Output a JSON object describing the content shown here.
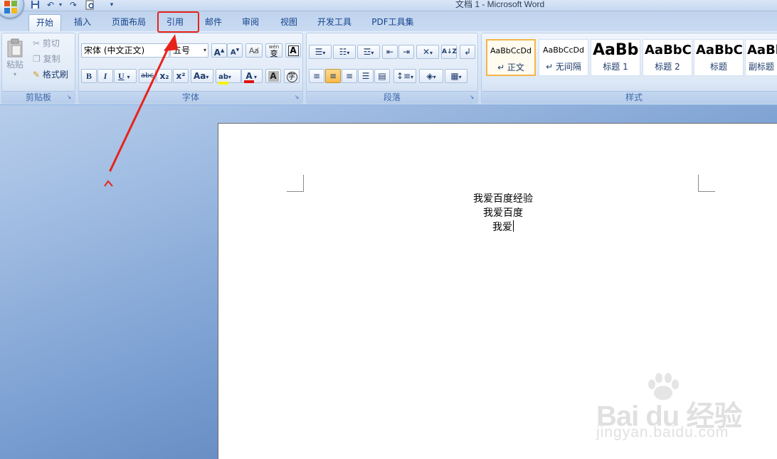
{
  "app": {
    "title": "文档 1 - Microsoft Word"
  },
  "quick_access": {
    "icons": [
      "save-icon",
      "undo-icon",
      "redo-icon",
      "print-preview-icon",
      "customize-icon"
    ]
  },
  "tabs": [
    {
      "label": "开始",
      "active": true
    },
    {
      "label": "插入",
      "active": false
    },
    {
      "label": "页面布局",
      "active": false
    },
    {
      "label": "引用",
      "active": false
    },
    {
      "label": "邮件",
      "active": false
    },
    {
      "label": "审阅",
      "active": false
    },
    {
      "label": "视图",
      "active": false
    },
    {
      "label": "开发工具",
      "active": false
    },
    {
      "label": "PDF工具集",
      "active": false
    }
  ],
  "clipboard": {
    "group_label": "剪贴板",
    "paste_label": "粘贴",
    "cut_label": "剪切",
    "copy_label": "复制",
    "format_painter_label": "格式刷"
  },
  "font": {
    "group_label": "字体",
    "font_name": "宋体 (中文正文)",
    "font_size": "五号",
    "grow_label": "A",
    "shrink_label": "A",
    "phonetic_label": "wén",
    "phonetic_char": "变",
    "border_char": "A",
    "bold_label": "B",
    "italic_label": "I",
    "underline_label": "U",
    "strike_label": "abc",
    "subscript_label": "x₂",
    "superscript_label": "x²",
    "case_label": "Aa",
    "highlight_label": "ab",
    "font_color_label": "A",
    "shading_char": "A",
    "enclose_char": "字",
    "colors": {
      "highlight": "#f6f200",
      "font": "#e01010"
    }
  },
  "paragraph": {
    "group_label": "段落",
    "sort_label": "A↓Z"
  },
  "styles": {
    "group_label": "样式",
    "items": [
      {
        "sample": "AaBbCcDd",
        "name": "↵ 正文",
        "selected": true
      },
      {
        "sample": "AaBbCcDd",
        "name": "↵ 无间隔",
        "selected": false
      },
      {
        "sample": "AaBb",
        "name": "标题 1",
        "selected": false
      },
      {
        "sample": "AaBbC",
        "name": "标题 2",
        "selected": false
      },
      {
        "sample": "AaBbC",
        "name": "标题",
        "selected": false
      },
      {
        "sample": "AaBl",
        "name": "副标题",
        "selected": false
      }
    ]
  },
  "document": {
    "lines": [
      "我爱百度经验",
      "我爱百度",
      "我爱"
    ]
  },
  "annotation": {
    "color": "#e8231a"
  },
  "watermark": {
    "brand": "Bai du 经验",
    "url": "jingyan.baidu.com"
  }
}
